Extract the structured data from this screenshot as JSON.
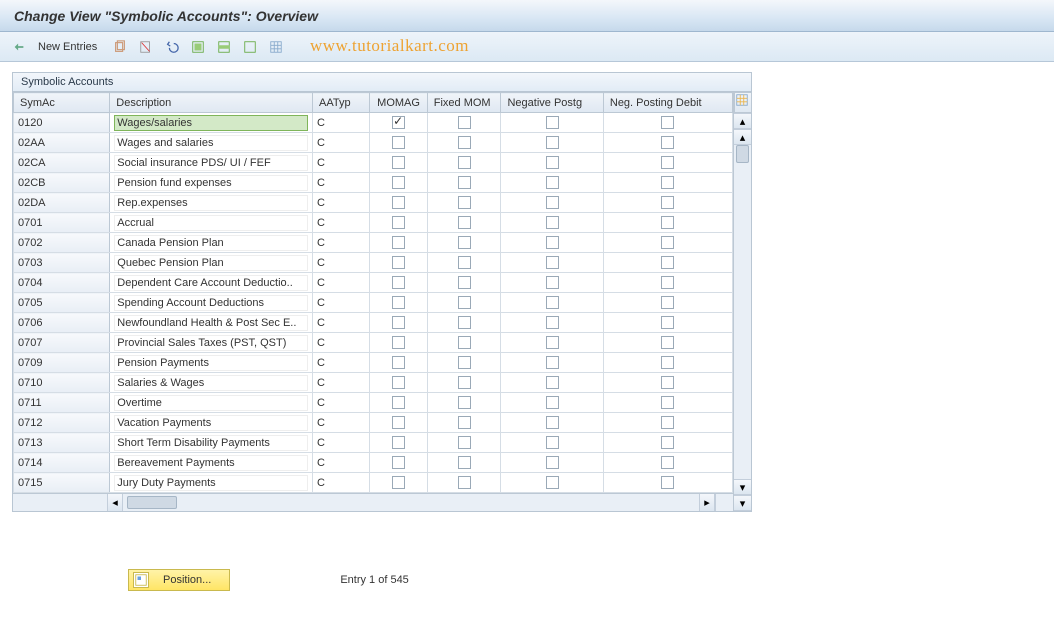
{
  "title": "Change View \"Symbolic Accounts\": Overview",
  "toolbar": {
    "new_entries_label": "New Entries"
  },
  "watermark": "www.tutorialkart.com",
  "panel": {
    "header": "Symbolic Accounts"
  },
  "columns": {
    "symac": "SymAc",
    "description": "Description",
    "aatyp": "AATyp",
    "momag": "MOMAG",
    "fixed_mom": "Fixed MOM",
    "negative_postg": "Negative Postg",
    "neg_posting_debit": "Neg. Posting Debit"
  },
  "rows": [
    {
      "symac": "0120",
      "description": "Wages/salaries",
      "aatyp": "C",
      "momag": true,
      "fixed": false,
      "neg": false,
      "negd": false,
      "selected": true
    },
    {
      "symac": "02AA",
      "description": "Wages and salaries",
      "aatyp": "C",
      "momag": false,
      "fixed": false,
      "neg": false,
      "negd": false
    },
    {
      "symac": "02CA",
      "description": "Social insurance PDS/ UI / FEF",
      "aatyp": "C",
      "momag": false,
      "fixed": false,
      "neg": false,
      "negd": false
    },
    {
      "symac": "02CB",
      "description": "Pension fund expenses",
      "aatyp": "C",
      "momag": false,
      "fixed": false,
      "neg": false,
      "negd": false
    },
    {
      "symac": "02DA",
      "description": "Rep.expenses",
      "aatyp": "C",
      "momag": false,
      "fixed": false,
      "neg": false,
      "negd": false
    },
    {
      "symac": "0701",
      "description": "Accrual",
      "aatyp": "C",
      "momag": false,
      "fixed": false,
      "neg": false,
      "negd": false
    },
    {
      "symac": "0702",
      "description": "Canada Pension Plan",
      "aatyp": "C",
      "momag": false,
      "fixed": false,
      "neg": false,
      "negd": false
    },
    {
      "symac": "0703",
      "description": "Quebec Pension Plan",
      "aatyp": "C",
      "momag": false,
      "fixed": false,
      "neg": false,
      "negd": false
    },
    {
      "symac": "0704",
      "description": "Dependent Care Account Deductio..",
      "aatyp": "C",
      "momag": false,
      "fixed": false,
      "neg": false,
      "negd": false
    },
    {
      "symac": "0705",
      "description": "Spending Account Deductions",
      "aatyp": "C",
      "momag": false,
      "fixed": false,
      "neg": false,
      "negd": false
    },
    {
      "symac": "0706",
      "description": "Newfoundland Health & Post Sec E..",
      "aatyp": "C",
      "momag": false,
      "fixed": false,
      "neg": false,
      "negd": false
    },
    {
      "symac": "0707",
      "description": "Provincial Sales Taxes (PST, QST)",
      "aatyp": "C",
      "momag": false,
      "fixed": false,
      "neg": false,
      "negd": false
    },
    {
      "symac": "0709",
      "description": "Pension Payments",
      "aatyp": "C",
      "momag": false,
      "fixed": false,
      "neg": false,
      "negd": false
    },
    {
      "symac": "0710",
      "description": "Salaries & Wages",
      "aatyp": "C",
      "momag": false,
      "fixed": false,
      "neg": false,
      "negd": false
    },
    {
      "symac": "0711",
      "description": "Overtime",
      "aatyp": "C",
      "momag": false,
      "fixed": false,
      "neg": false,
      "negd": false
    },
    {
      "symac": "0712",
      "description": "Vacation Payments",
      "aatyp": "C",
      "momag": false,
      "fixed": false,
      "neg": false,
      "negd": false
    },
    {
      "symac": "0713",
      "description": "Short Term Disability Payments",
      "aatyp": "C",
      "momag": false,
      "fixed": false,
      "neg": false,
      "negd": false
    },
    {
      "symac": "0714",
      "description": "Bereavement Payments",
      "aatyp": "C",
      "momag": false,
      "fixed": false,
      "neg": false,
      "negd": false
    },
    {
      "symac": "0715",
      "description": "Jury Duty Payments",
      "aatyp": "C",
      "momag": false,
      "fixed": false,
      "neg": false,
      "negd": false
    }
  ],
  "footer": {
    "position_label": "Position...",
    "entry_text": "Entry 1 of 545"
  }
}
